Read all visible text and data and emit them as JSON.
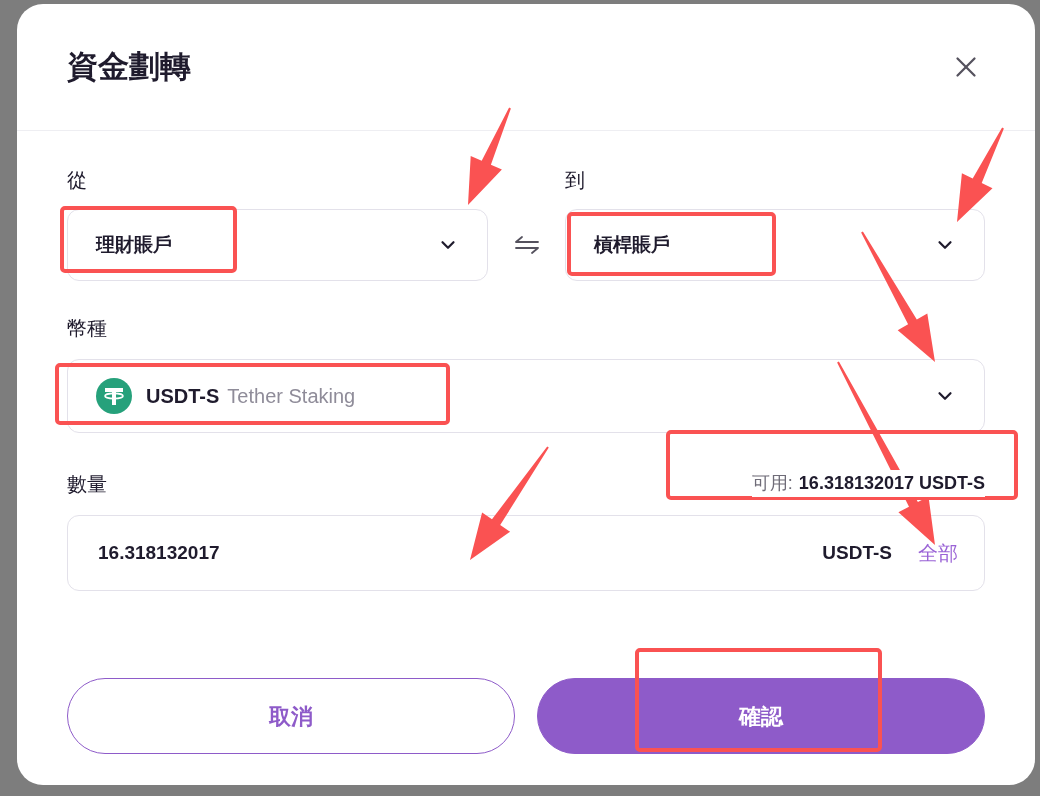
{
  "dialog": {
    "title": "資金劃轉"
  },
  "from": {
    "label": "從",
    "value": "理財賬戶"
  },
  "to": {
    "label": "到",
    "value": "槓桿賬戶"
  },
  "currency": {
    "label": "幣種",
    "symbol": "USDT-S",
    "name": "Tether Staking"
  },
  "amount": {
    "label": "數量",
    "available_label": "可用:",
    "available_value": "16.318132017 USDT-S",
    "value": "16.318132017",
    "unit": "USDT-S",
    "max_link": "全部"
  },
  "buttons": [
    {
      "label": "取消",
      "kind": "secondary"
    },
    {
      "label": "確認",
      "kind": "primary"
    }
  ]
}
